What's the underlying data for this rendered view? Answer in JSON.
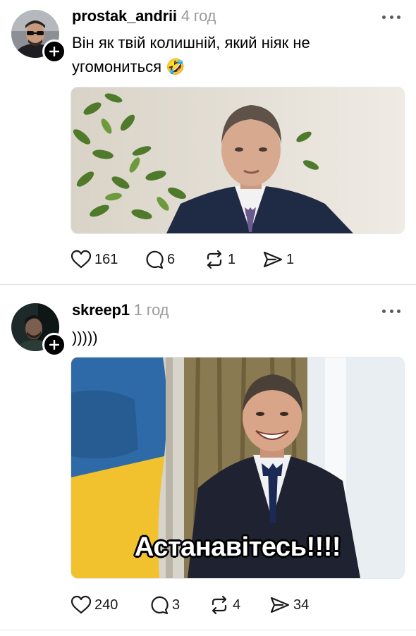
{
  "posts": [
    {
      "username": "prostak_andrii",
      "time": "4 год",
      "text_lines": [
        "Він як твій колишній, який ніяк не",
        "угомониться 🤣"
      ],
      "actions": {
        "likes": "161",
        "replies": "6",
        "reposts": "1",
        "shares": "1"
      }
    },
    {
      "username": "skreep1",
      "time": "1 год",
      "text_lines": [
        ")))))"
      ],
      "image_caption": "Астанавітесь!!!!",
      "actions": {
        "likes": "240",
        "replies": "3",
        "reposts": "4",
        "shares": "34"
      }
    }
  ],
  "colors": {
    "text": "#000000",
    "muted": "#9a9a9a",
    "divider": "#e3e3e3",
    "flag_blue": "#2f6aa8",
    "flag_yellow": "#f2c12e"
  },
  "icons": [
    "plus-icon",
    "more-icon",
    "heart-icon",
    "reply-icon",
    "repost-icon",
    "share-icon"
  ]
}
